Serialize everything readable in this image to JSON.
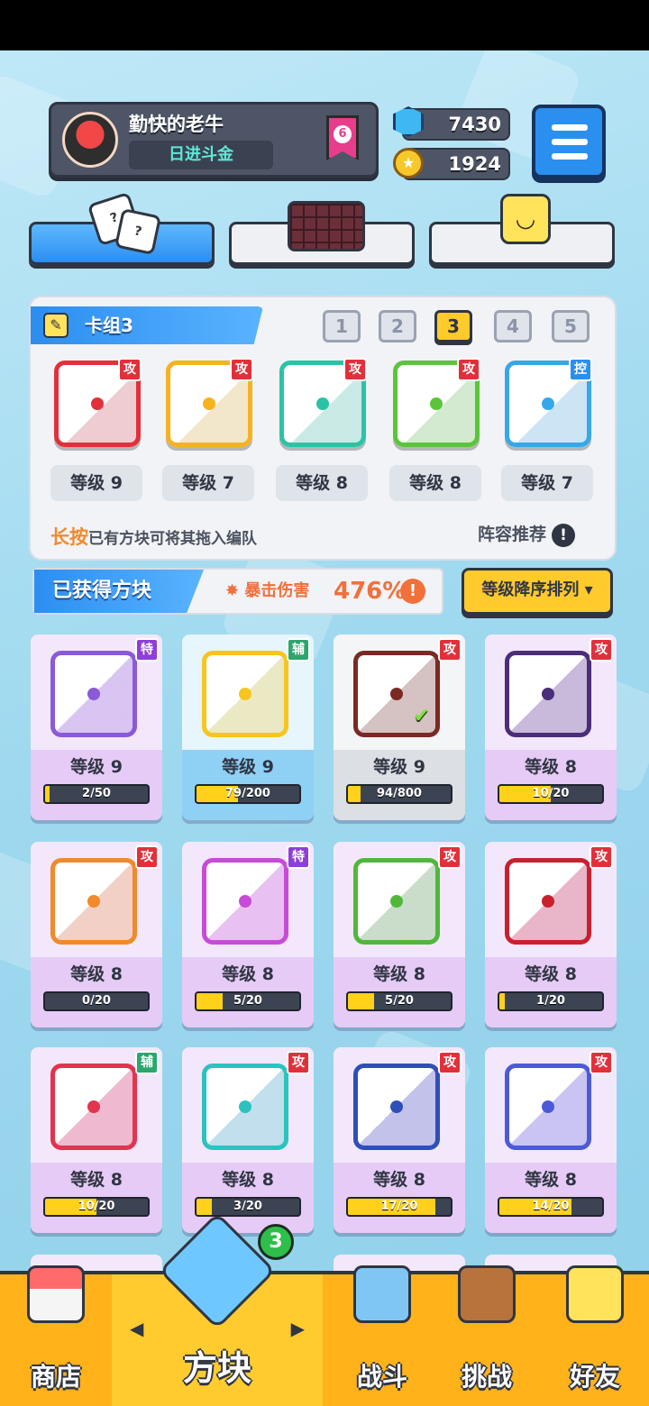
{
  "header": {
    "player_name": "勤快的老牛",
    "player_title": "日进斗金",
    "rank_badge": "6",
    "gems": "7430",
    "coins": "1924"
  },
  "deck": {
    "name": "卡组3",
    "numbers": [
      "1",
      "2",
      "3",
      "4",
      "5"
    ],
    "active_number": "3",
    "slots": [
      {
        "tag": "攻",
        "level": "等级 9",
        "color": "#e2303b"
      },
      {
        "tag": "攻",
        "level": "等级 7",
        "color": "#f7b21f"
      },
      {
        "tag": "攻",
        "level": "等级 8",
        "color": "#2bc3a5"
      },
      {
        "tag": "攻",
        "level": "等级 8",
        "color": "#5bc53a"
      },
      {
        "tag": "控",
        "level": "等级 7",
        "color": "#35a8ea"
      }
    ],
    "hint_emphasis": "长按",
    "hint_text": "已有方块可将其拖入编队",
    "recommend": "阵容推荐"
  },
  "obtained": {
    "label": "已获得方块",
    "crit_label": "暴击伤害",
    "crit_value": "476%",
    "sort_label": "等级降序排列 ▾"
  },
  "blocks": [
    {
      "tag": "特",
      "level": "等级 9",
      "progress": "2/50",
      "fill": 0.04,
      "color": "#8a5ad8"
    },
    {
      "tag": "辅",
      "level": "等级 9",
      "progress": "79/200",
      "fill": 0.4,
      "color": "#f7c51f"
    },
    {
      "tag": "攻",
      "level": "等级 9",
      "progress": "94/800",
      "fill": 0.12,
      "color": "#7a2a24"
    },
    {
      "tag": "攻",
      "level": "等级 8",
      "progress": "10/20",
      "fill": 0.5,
      "color": "#4b2d7a"
    },
    {
      "tag": "攻",
      "level": "等级 8",
      "progress": "0/20",
      "fill": 0.0,
      "color": "#f08a2a"
    },
    {
      "tag": "特",
      "level": "等级 8",
      "progress": "5/20",
      "fill": 0.25,
      "color": "#c84bd8"
    },
    {
      "tag": "攻",
      "level": "等级 8",
      "progress": "5/20",
      "fill": 0.25,
      "color": "#4fb83a"
    },
    {
      "tag": "攻",
      "level": "等级 8",
      "progress": "1/20",
      "fill": 0.05,
      "color": "#c9202e"
    },
    {
      "tag": "辅",
      "level": "等级 8",
      "progress": "10/20",
      "fill": 0.5,
      "color": "#e2334f"
    },
    {
      "tag": "攻",
      "level": "等级 8",
      "progress": "3/20",
      "fill": 0.15,
      "color": "#2bc3c0"
    },
    {
      "tag": "攻",
      "level": "等级 8",
      "progress": "17/20",
      "fill": 0.85,
      "color": "#2f4fb8"
    },
    {
      "tag": "攻",
      "level": "等级 8",
      "progress": "14/20",
      "fill": 0.7,
      "color": "#4d5ad8"
    }
  ],
  "nav": {
    "shop": "商店",
    "blocks": "方块",
    "blocks_badge": "3",
    "battle": "战斗",
    "challenge": "挑战",
    "friends": "好友"
  }
}
